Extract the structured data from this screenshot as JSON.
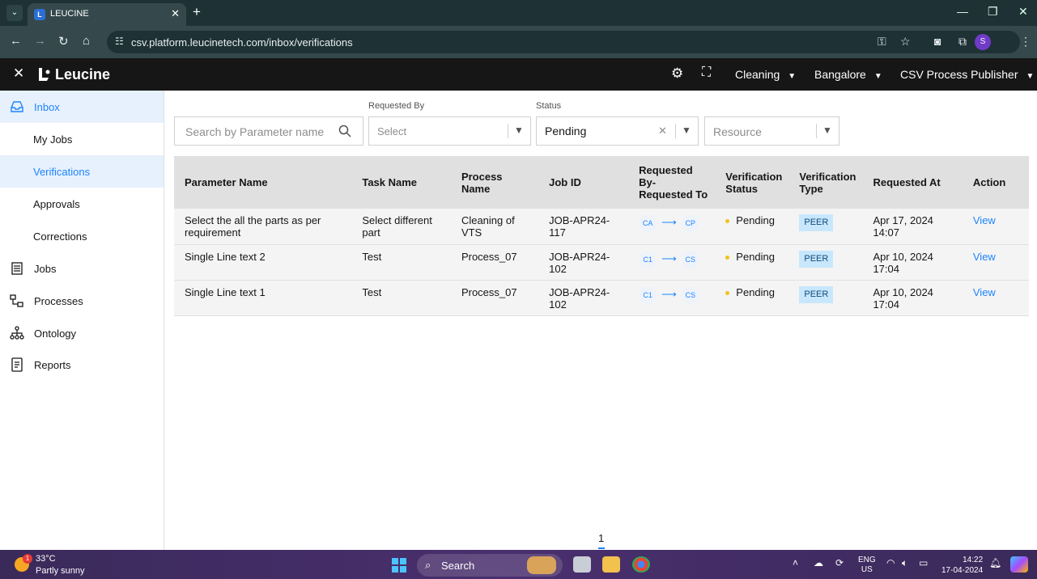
{
  "browser": {
    "tab_title": "LEUCINE",
    "url": "csv.platform.leucinetech.com/inbox/verifications",
    "profile_initial": "S"
  },
  "appbar": {
    "brand": "Leucine",
    "facility": "Cleaning",
    "location": "Bangalore",
    "role": "CSV Process Publisher"
  },
  "sidebar": {
    "items": [
      {
        "label": "Inbox"
      },
      {
        "label": "My Jobs"
      },
      {
        "label": "Verifications"
      },
      {
        "label": "Approvals"
      },
      {
        "label": "Corrections"
      },
      {
        "label": "Jobs"
      },
      {
        "label": "Processes"
      },
      {
        "label": "Ontology"
      },
      {
        "label": "Reports"
      }
    ]
  },
  "filters": {
    "search_placeholder": "Search by Parameter name",
    "requested_by_label": "Requested By",
    "requested_by_value": "Select",
    "status_label": "Status",
    "status_value": "Pending",
    "resource_placeholder": "Resource"
  },
  "table": {
    "headers": [
      "Parameter Name",
      "Task Name",
      "Process Name",
      "Job ID",
      "Requested By- Requested To",
      "Verification Status",
      "Verification Type",
      "Requested At",
      "Action"
    ],
    "rows": [
      {
        "parameter": "Select the all the parts as per requirement",
        "task": "Select different part",
        "process": "Cleaning of VTS",
        "job_id": "JOB-APR24-117",
        "from": "CA",
        "to": "CP",
        "status": "Pending",
        "type": "PEER",
        "requested_at": "Apr 17, 2024 14:07",
        "action": "View"
      },
      {
        "parameter": "Single Line text 2",
        "task": "Test",
        "process": "Process_07",
        "job_id": "JOB-APR24-102",
        "from": "C1",
        "to": "CS",
        "status": "Pending",
        "type": "PEER",
        "requested_at": "Apr 10, 2024 17:04",
        "action": "View"
      },
      {
        "parameter": "Single Line text 1",
        "task": "Test",
        "process": "Process_07",
        "job_id": "JOB-APR24-102",
        "from": "C1",
        "to": "CS",
        "status": "Pending",
        "type": "PEER",
        "requested_at": "Apr 10, 2024 17:04",
        "action": "View"
      }
    ]
  },
  "pagination": {
    "current": "1"
  },
  "taskbar": {
    "weather_temp": "33°C",
    "weather_desc": "Partly sunny",
    "weather_badge": "1",
    "search_label": "Search",
    "lang_1": "ENG",
    "lang_2": "US",
    "time": "14:22",
    "date": "17-04-2024"
  },
  "colors": {
    "accent": "#1d84ff",
    "appbar": "#161616",
    "active_bg": "#e7f1fd",
    "pending": "#f1c21b",
    "peer_bg": "#c8e7fd"
  }
}
